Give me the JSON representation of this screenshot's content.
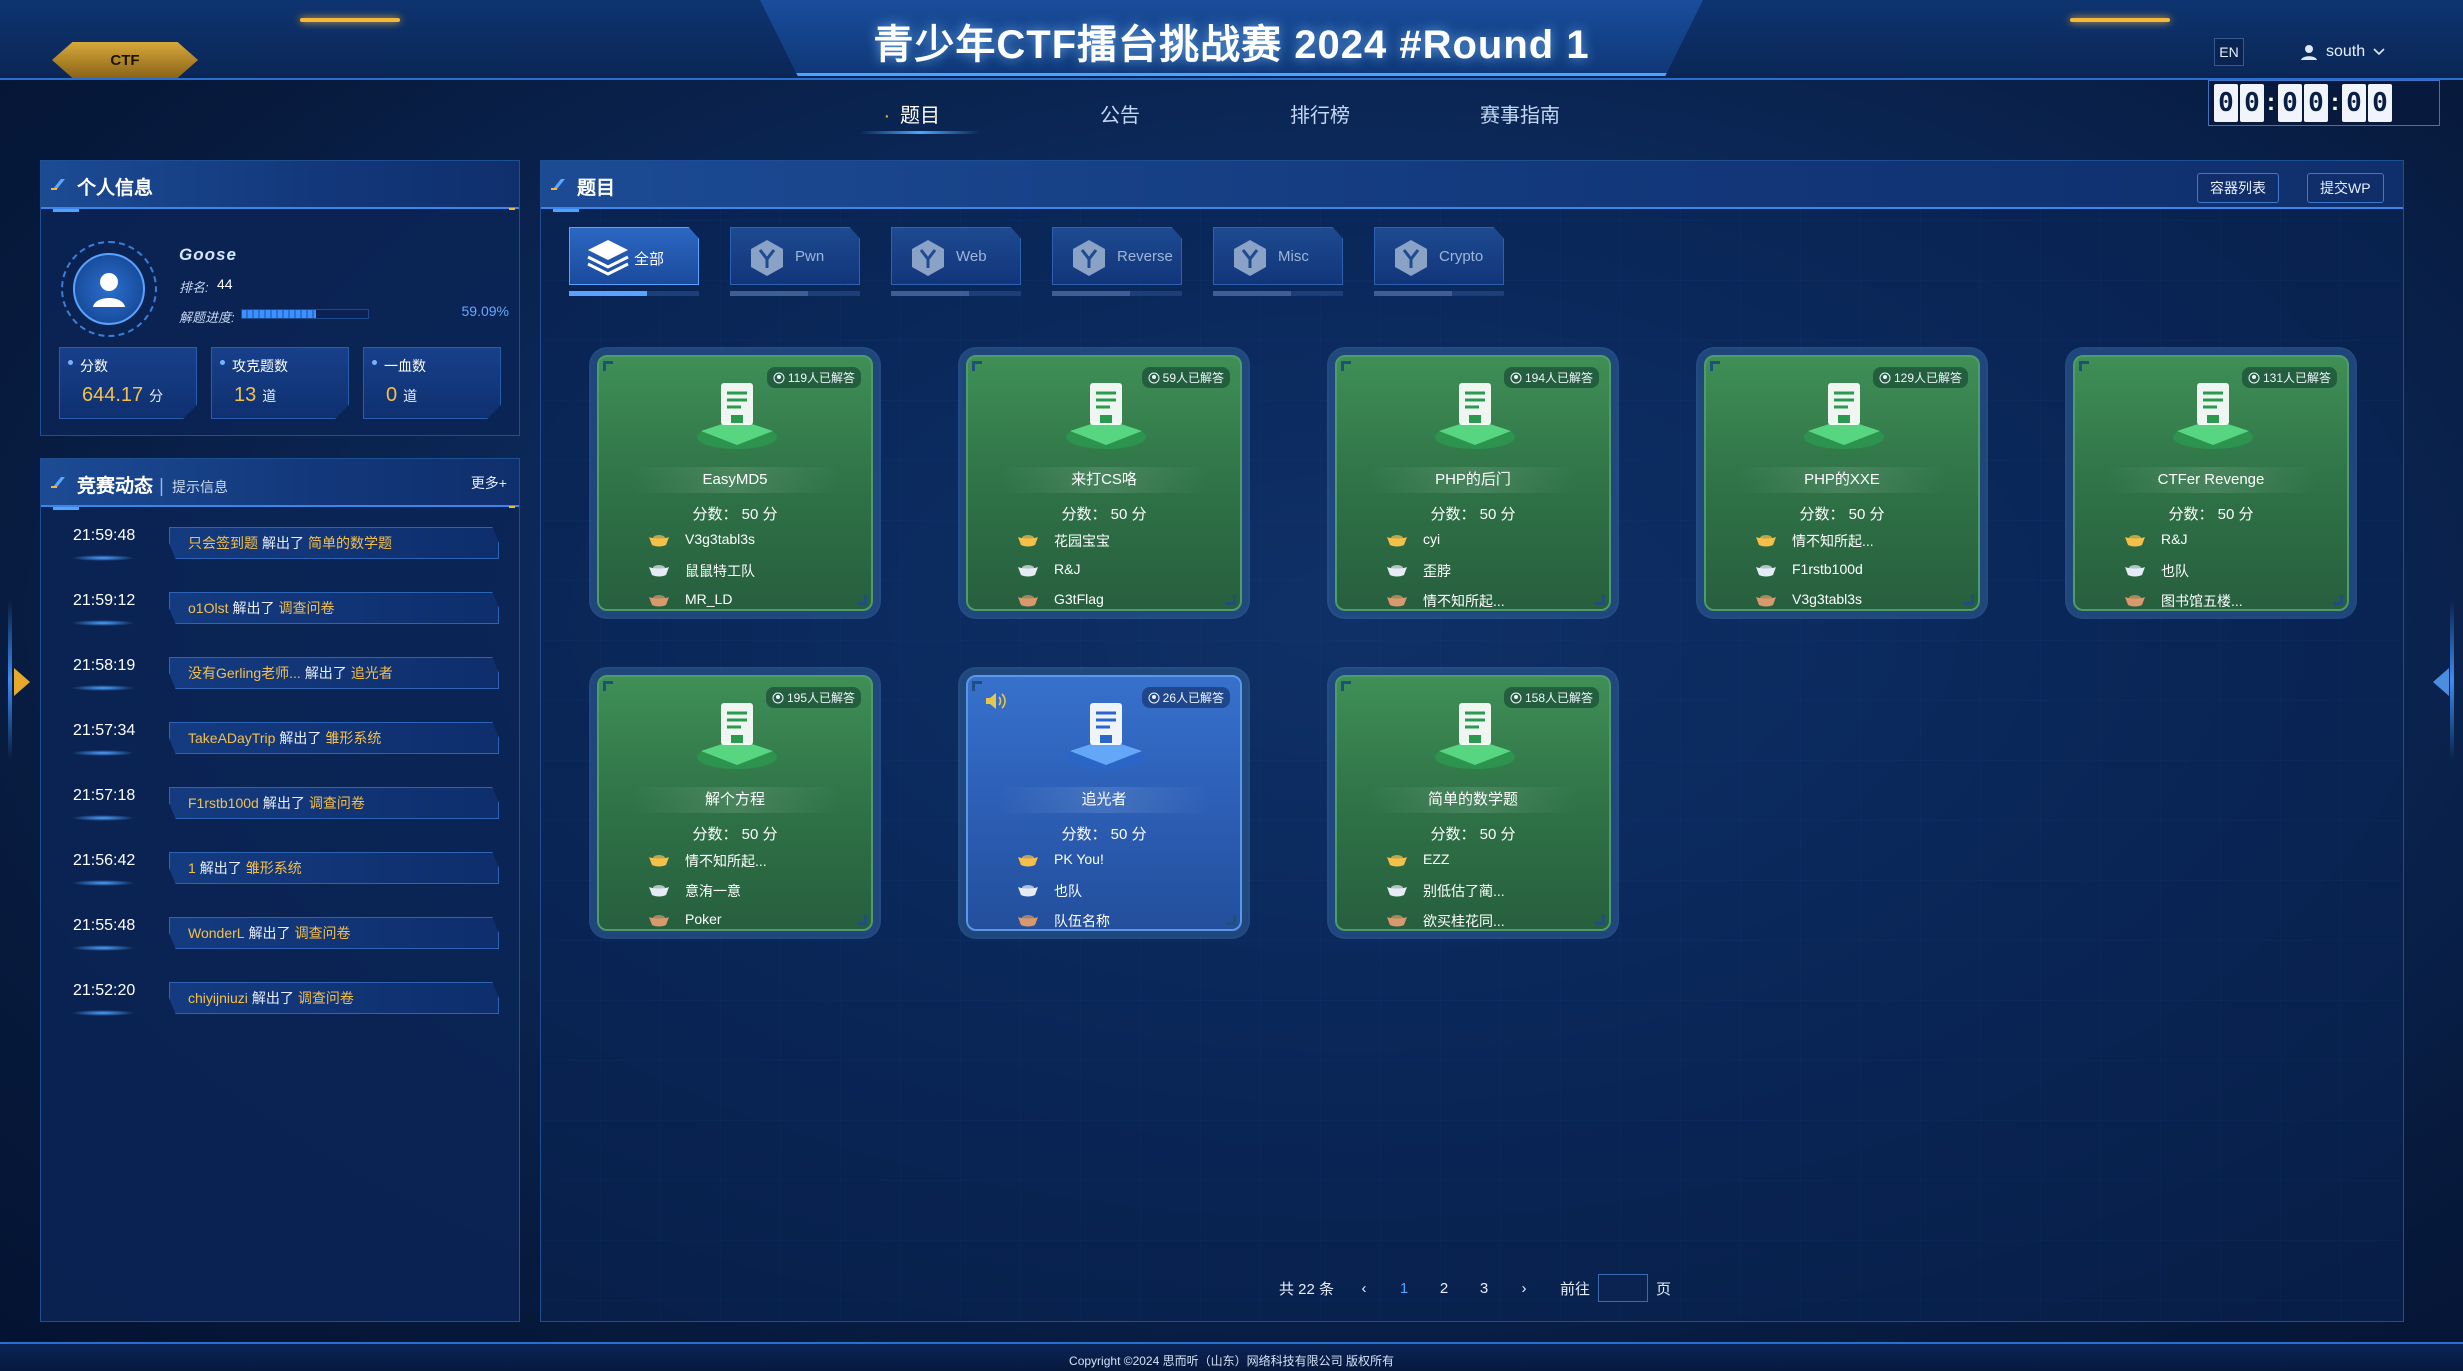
{
  "header": {
    "title": "青少年CTF擂台挑战赛 2024 #Round 1",
    "logo": "CTF",
    "lang": "EN",
    "user": "south",
    "timer": [
      "0",
      "0",
      ":",
      "0",
      "0",
      ":",
      "0",
      "0"
    ]
  },
  "nav": [
    {
      "label": "题目",
      "active": true
    },
    {
      "label": "公告",
      "active": false
    },
    {
      "label": "排行榜",
      "active": false
    },
    {
      "label": "赛事指南",
      "active": false
    }
  ],
  "profile": {
    "panel_title": "个人信息",
    "name": "Goose",
    "rank_label": "排名:",
    "rank": "44",
    "progress_label": "解题进度:",
    "progress_value": "59.09%",
    "progress": 0.5909,
    "stats": [
      {
        "label": "分数",
        "value": "644.17",
        "unit": "分"
      },
      {
        "label": "攻克题数",
        "value": "13",
        "unit": "道"
      },
      {
        "label": "一血数",
        "value": "0",
        "unit": "道"
      }
    ]
  },
  "feed": {
    "panel_title": "竞赛动态",
    "subtitle": "提示信息",
    "more": "更多+",
    "items": [
      {
        "time": "21:59:48",
        "who": "只会签到题",
        "action": "解出了",
        "what": "简单的数学题"
      },
      {
        "time": "21:59:12",
        "who": "o1Olst",
        "action": "解出了",
        "what": "调查问卷"
      },
      {
        "time": "21:58:19",
        "who": "没有Gerling老师...",
        "action": "解出了",
        "what": "追光者"
      },
      {
        "time": "21:57:34",
        "who": "TakeADayTrip",
        "action": "解出了",
        "what": "雏形系统"
      },
      {
        "time": "21:57:18",
        "who": "F1rstb100d",
        "action": "解出了",
        "what": "调查问卷"
      },
      {
        "time": "21:56:42",
        "who": "1",
        "action": "解出了",
        "what": "雏形系统"
      },
      {
        "time": "21:55:48",
        "who": "WonderL",
        "action": "解出了",
        "what": "调查问卷"
      },
      {
        "time": "21:52:20",
        "who": "chiyijniuzi",
        "action": "解出了",
        "what": "调查问卷"
      }
    ]
  },
  "main": {
    "panel_title": "题目",
    "buttons": {
      "containers": "容器列表",
      "submit_wp": "提交WP"
    },
    "tabs": [
      {
        "label": "全部",
        "active": true
      },
      {
        "label": "Pwn",
        "active": false
      },
      {
        "label": "Web",
        "active": false
      },
      {
        "label": "Reverse",
        "active": false
      },
      {
        "label": "Misc",
        "active": false
      },
      {
        "label": "Crypto",
        "active": false
      }
    ],
    "cards": [
      {
        "name": "EasyMD5",
        "solved": "119人已解答",
        "score": "分数： 50 分",
        "solvers": [
          "V3g3tabl3s",
          "鼠鼠特工队",
          "MR_LD"
        ],
        "color": "green"
      },
      {
        "name": "来打CS咯",
        "solved": "59人已解答",
        "score": "分数： 50 分",
        "solvers": [
          "花园宝宝",
          "R&J",
          "G3tFlag"
        ],
        "color": "green"
      },
      {
        "name": "PHP的后门",
        "solved": "194人已解答",
        "score": "分数： 50 分",
        "solvers": [
          "cyi",
          "歪脖",
          "情不知所起..."
        ],
        "color": "green"
      },
      {
        "name": "PHP的XXE",
        "solved": "129人已解答",
        "score": "分数： 50 分",
        "solvers": [
          "情不知所起...",
          "F1rstb100d",
          "V3g3tabl3s"
        ],
        "color": "green"
      },
      {
        "name": "CTFer Revenge",
        "solved": "131人已解答",
        "score": "分数： 50 分",
        "solvers": [
          "R&J",
          "也队",
          "图书馆五楼..."
        ],
        "color": "green"
      },
      {
        "name": "解个方程",
        "solved": "195人已解答",
        "score": "分数： 50 分",
        "solvers": [
          "情不知所起...",
          "意洧一意",
          "Poker"
        ],
        "color": "green"
      },
      {
        "name": "追光者",
        "solved": "26人已解答",
        "score": "分数： 50 分",
        "solvers": [
          "PK You!",
          "也队",
          "队伍名称"
        ],
        "color": "blue"
      },
      {
        "name": "简单的数学题",
        "solved": "158人已解答",
        "score": "分数： 50 分",
        "solvers": [
          "EZZ",
          "别低估了蔺...",
          "欲买桂花同..."
        ],
        "color": "green"
      }
    ]
  },
  "pager": {
    "total": "共 22 条",
    "prev": "‹",
    "next": "›",
    "pages": [
      "1",
      "2",
      "3"
    ],
    "current": "1",
    "goto_label": "前往",
    "page_suffix": "页"
  },
  "footer": {
    "copyright": "Copyright ©2024  思而听（山东）网络科技有限公司  版权所有"
  },
  "colors": {
    "accent": "#4da3ff",
    "gold": "#f5c04a",
    "card_green": "#2f7347",
    "card_blue": "#2c5fb6"
  }
}
